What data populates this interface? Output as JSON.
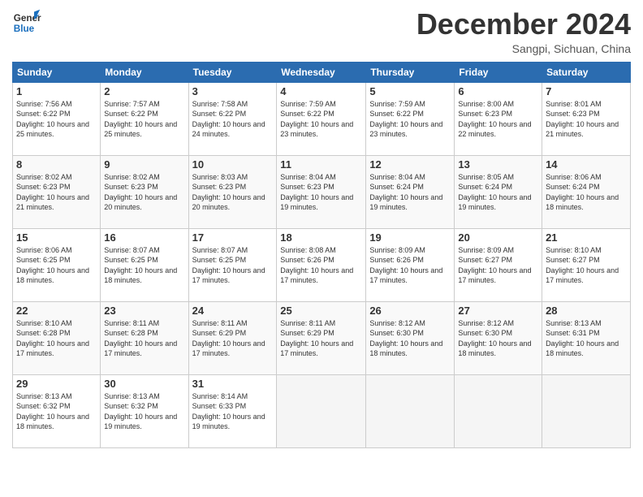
{
  "header": {
    "logo_general": "General",
    "logo_blue": "Blue",
    "month": "December 2024",
    "location": "Sangpi, Sichuan, China"
  },
  "days_of_week": [
    "Sunday",
    "Monday",
    "Tuesday",
    "Wednesday",
    "Thursday",
    "Friday",
    "Saturday"
  ],
  "weeks": [
    [
      {
        "day": "1",
        "sunrise": "Sunrise: 7:56 AM",
        "sunset": "Sunset: 6:22 PM",
        "daylight": "Daylight: 10 hours and 25 minutes."
      },
      {
        "day": "2",
        "sunrise": "Sunrise: 7:57 AM",
        "sunset": "Sunset: 6:22 PM",
        "daylight": "Daylight: 10 hours and 25 minutes."
      },
      {
        "day": "3",
        "sunrise": "Sunrise: 7:58 AM",
        "sunset": "Sunset: 6:22 PM",
        "daylight": "Daylight: 10 hours and 24 minutes."
      },
      {
        "day": "4",
        "sunrise": "Sunrise: 7:59 AM",
        "sunset": "Sunset: 6:22 PM",
        "daylight": "Daylight: 10 hours and 23 minutes."
      },
      {
        "day": "5",
        "sunrise": "Sunrise: 7:59 AM",
        "sunset": "Sunset: 6:22 PM",
        "daylight": "Daylight: 10 hours and 23 minutes."
      },
      {
        "day": "6",
        "sunrise": "Sunrise: 8:00 AM",
        "sunset": "Sunset: 6:23 PM",
        "daylight": "Daylight: 10 hours and 22 minutes."
      },
      {
        "day": "7",
        "sunrise": "Sunrise: 8:01 AM",
        "sunset": "Sunset: 6:23 PM",
        "daylight": "Daylight: 10 hours and 21 minutes."
      }
    ],
    [
      {
        "day": "8",
        "sunrise": "Sunrise: 8:02 AM",
        "sunset": "Sunset: 6:23 PM",
        "daylight": "Daylight: 10 hours and 21 minutes."
      },
      {
        "day": "9",
        "sunrise": "Sunrise: 8:02 AM",
        "sunset": "Sunset: 6:23 PM",
        "daylight": "Daylight: 10 hours and 20 minutes."
      },
      {
        "day": "10",
        "sunrise": "Sunrise: 8:03 AM",
        "sunset": "Sunset: 6:23 PM",
        "daylight": "Daylight: 10 hours and 20 minutes."
      },
      {
        "day": "11",
        "sunrise": "Sunrise: 8:04 AM",
        "sunset": "Sunset: 6:23 PM",
        "daylight": "Daylight: 10 hours and 19 minutes."
      },
      {
        "day": "12",
        "sunrise": "Sunrise: 8:04 AM",
        "sunset": "Sunset: 6:24 PM",
        "daylight": "Daylight: 10 hours and 19 minutes."
      },
      {
        "day": "13",
        "sunrise": "Sunrise: 8:05 AM",
        "sunset": "Sunset: 6:24 PM",
        "daylight": "Daylight: 10 hours and 19 minutes."
      },
      {
        "day": "14",
        "sunrise": "Sunrise: 8:06 AM",
        "sunset": "Sunset: 6:24 PM",
        "daylight": "Daylight: 10 hours and 18 minutes."
      }
    ],
    [
      {
        "day": "15",
        "sunrise": "Sunrise: 8:06 AM",
        "sunset": "Sunset: 6:25 PM",
        "daylight": "Daylight: 10 hours and 18 minutes."
      },
      {
        "day": "16",
        "sunrise": "Sunrise: 8:07 AM",
        "sunset": "Sunset: 6:25 PM",
        "daylight": "Daylight: 10 hours and 18 minutes."
      },
      {
        "day": "17",
        "sunrise": "Sunrise: 8:07 AM",
        "sunset": "Sunset: 6:25 PM",
        "daylight": "Daylight: 10 hours and 17 minutes."
      },
      {
        "day": "18",
        "sunrise": "Sunrise: 8:08 AM",
        "sunset": "Sunset: 6:26 PM",
        "daylight": "Daylight: 10 hours and 17 minutes."
      },
      {
        "day": "19",
        "sunrise": "Sunrise: 8:09 AM",
        "sunset": "Sunset: 6:26 PM",
        "daylight": "Daylight: 10 hours and 17 minutes."
      },
      {
        "day": "20",
        "sunrise": "Sunrise: 8:09 AM",
        "sunset": "Sunset: 6:27 PM",
        "daylight": "Daylight: 10 hours and 17 minutes."
      },
      {
        "day": "21",
        "sunrise": "Sunrise: 8:10 AM",
        "sunset": "Sunset: 6:27 PM",
        "daylight": "Daylight: 10 hours and 17 minutes."
      }
    ],
    [
      {
        "day": "22",
        "sunrise": "Sunrise: 8:10 AM",
        "sunset": "Sunset: 6:28 PM",
        "daylight": "Daylight: 10 hours and 17 minutes."
      },
      {
        "day": "23",
        "sunrise": "Sunrise: 8:11 AM",
        "sunset": "Sunset: 6:28 PM",
        "daylight": "Daylight: 10 hours and 17 minutes."
      },
      {
        "day": "24",
        "sunrise": "Sunrise: 8:11 AM",
        "sunset": "Sunset: 6:29 PM",
        "daylight": "Daylight: 10 hours and 17 minutes."
      },
      {
        "day": "25",
        "sunrise": "Sunrise: 8:11 AM",
        "sunset": "Sunset: 6:29 PM",
        "daylight": "Daylight: 10 hours and 17 minutes."
      },
      {
        "day": "26",
        "sunrise": "Sunrise: 8:12 AM",
        "sunset": "Sunset: 6:30 PM",
        "daylight": "Daylight: 10 hours and 18 minutes."
      },
      {
        "day": "27",
        "sunrise": "Sunrise: 8:12 AM",
        "sunset": "Sunset: 6:30 PM",
        "daylight": "Daylight: 10 hours and 18 minutes."
      },
      {
        "day": "28",
        "sunrise": "Sunrise: 8:13 AM",
        "sunset": "Sunset: 6:31 PM",
        "daylight": "Daylight: 10 hours and 18 minutes."
      }
    ],
    [
      {
        "day": "29",
        "sunrise": "Sunrise: 8:13 AM",
        "sunset": "Sunset: 6:32 PM",
        "daylight": "Daylight: 10 hours and 18 minutes."
      },
      {
        "day": "30",
        "sunrise": "Sunrise: 8:13 AM",
        "sunset": "Sunset: 6:32 PM",
        "daylight": "Daylight: 10 hours and 19 minutes."
      },
      {
        "day": "31",
        "sunrise": "Sunrise: 8:14 AM",
        "sunset": "Sunset: 6:33 PM",
        "daylight": "Daylight: 10 hours and 19 minutes."
      },
      null,
      null,
      null,
      null
    ]
  ]
}
